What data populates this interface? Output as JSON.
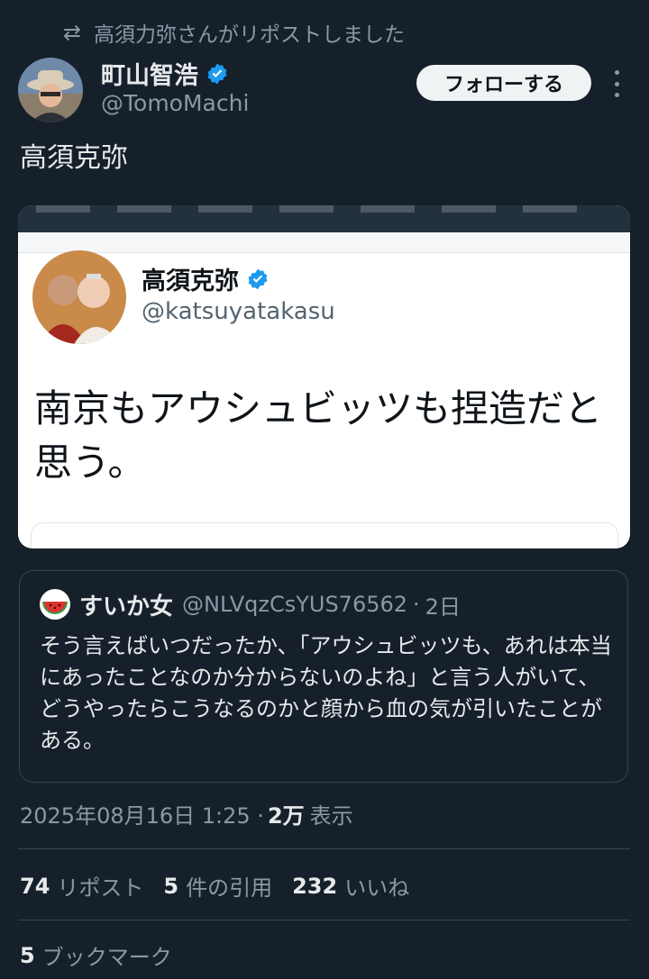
{
  "repost_banner": {
    "icon": "repost-icon",
    "text": "高須力弥さんがリポストしました"
  },
  "author": {
    "name": "町山智浩",
    "handle": "@TomoMachi",
    "verified": true
  },
  "actions": {
    "follow_label": "フォローする",
    "more_icon": "more-vertical-icon"
  },
  "post": {
    "text": "高須克弥"
  },
  "embedded_image": {
    "name": "高須克弥",
    "handle": "@katsuyatakasu",
    "text_line1": "南京もアウシュビッツも捏造だと",
    "text_line2": "思う。"
  },
  "quote": {
    "name": "すいか女",
    "handle": "@NLVqzCsYUS76562",
    "separator": "·",
    "time": "2日",
    "text": "そう言えばいつだったか、「アウシュビッツも、あれは本当にあったことなのか分からないのよね」と言う人がいて、どうやったらこうなるのかと顔から血の気が引いたことがある。"
  },
  "meta": {
    "timestamp": "2025年08月16日 1:25 ·",
    "views_count": "2万",
    "views_label": "表示"
  },
  "stats": {
    "reposts_count": "74",
    "reposts_label": "リポスト",
    "quotes_count": "5",
    "quotes_label": "件の引用",
    "likes_count": "232",
    "likes_label": "いいね",
    "bookmarks_count": "5",
    "bookmarks_label": "ブックマーク"
  },
  "colors": {
    "background": "#15202b",
    "verified": "#1d9bf0",
    "muted": "#8b98a5",
    "text": "#e7e9ea"
  }
}
